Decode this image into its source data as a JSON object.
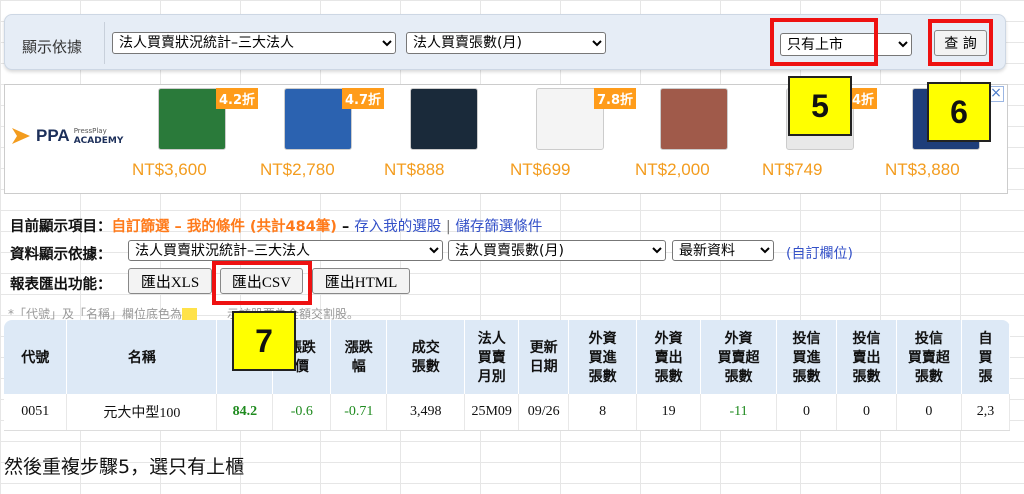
{
  "filter": {
    "label": "顯示依據",
    "select1": "法人買賣狀況統計–三大法人",
    "select2": "法人買賣張數(月)",
    "market": "只有上市",
    "query_button": "查 詢"
  },
  "ad": {
    "brand_small": "PressPlay",
    "brand_main": "PPA",
    "brand_sub": "ACADEMY",
    "items": [
      {
        "price": "NT$3,600",
        "discount": "4.2折",
        "color": "#2a7a3a"
      },
      {
        "price": "NT$2,780",
        "discount": "4.7折",
        "color": "#2b62b0"
      },
      {
        "price": "NT$888",
        "discount": "",
        "color": "#1a2a3a"
      },
      {
        "price": "NT$699",
        "discount": "7.8折",
        "color": "#f4f4f4"
      },
      {
        "price": "NT$2,000",
        "discount": "",
        "color": "#a05a4a"
      },
      {
        "price": "NT$749",
        "discount": ".4折",
        "color": "#e8e8e8"
      },
      {
        "price": "NT$3,880",
        "discount": "",
        "color": "#1f3e7a"
      }
    ],
    "close": "×"
  },
  "callouts": {
    "c5": "5",
    "c6": "6",
    "c7": "7"
  },
  "current": {
    "label": "目前顯示項目：",
    "value": "自訂篩選 – 我的條件 (共計484筆)",
    "dash": " – ",
    "link1": "存入我的選股",
    "sep": " | ",
    "link2": "儲存篩選條件"
  },
  "data_basis": {
    "label": "資料顯示依據：",
    "select1": "法人買賣狀況統計–三大法人",
    "select2": "法人買賣張數(月)",
    "select3": "最新資料",
    "custom": "(自訂欄位)"
  },
  "export": {
    "label": "報表匯出功能：",
    "xls": "匯出XLS",
    "csv": "匯出CSV",
    "html": "匯出HTML"
  },
  "note": {
    "pre": "*「代號」及「名稱」欄位底色為",
    "post": "示該股票為全額交割股。"
  },
  "table": {
    "headers": [
      [
        "代號"
      ],
      [
        "名稱"
      ],
      [
        "成"
      ],
      [
        "漲跌",
        "價"
      ],
      [
        "漲跌",
        "幅"
      ],
      [
        "成交",
        "張數"
      ],
      [
        "法人",
        "買賣",
        "月別"
      ],
      [
        "更新",
        "日期"
      ],
      [
        "外資",
        "買進",
        "張數"
      ],
      [
        "外資",
        "賣出",
        "張數"
      ],
      [
        "外資",
        "買賣超",
        "張數"
      ],
      [
        "投信",
        "買進",
        "張數"
      ],
      [
        "投信",
        "賣出",
        "張數"
      ],
      [
        "投信",
        "買賣超",
        "張數"
      ],
      [
        "自",
        "買",
        "張"
      ]
    ],
    "row": [
      "0051",
      "元大中型100",
      "84.2",
      "-0.6",
      "-0.71",
      "3,498",
      "25M09",
      "09/26",
      "8",
      "19",
      "-11",
      "0",
      "0",
      "0",
      "2,3"
    ]
  },
  "bottom_text": "然後重複步驟5，選只有上櫃"
}
